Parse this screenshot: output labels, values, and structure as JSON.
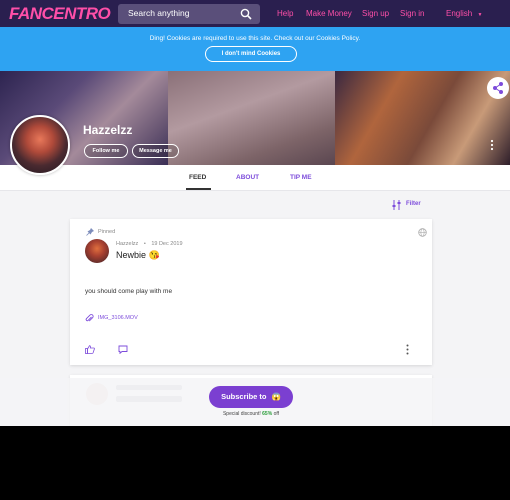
{
  "header": {
    "logo": "FANCENTRO",
    "search_placeholder": "Search anything",
    "links": [
      "Help",
      "Make Money",
      "Sign up",
      "Sign in"
    ],
    "language": "English"
  },
  "cookie_banner": {
    "text": "Ding! Cookies are required to use this site. Check out our Cookies Policy.",
    "button": "I don't mind Cookies"
  },
  "profile": {
    "name": "Hazzelzz",
    "follow_label": "Follow me",
    "message_label": "Message me"
  },
  "tabs": [
    {
      "label": "FEED",
      "active": true
    },
    {
      "label": "ABOUT",
      "active": false
    },
    {
      "label": "TIP ME",
      "active": false
    }
  ],
  "filter_label": "Filter",
  "post": {
    "pinned_label": "Pinned",
    "author": "Hazzelzz",
    "separator": "•",
    "date": "19 Dec 2019",
    "title": "Newbie 😘",
    "body": "you should come play with me",
    "attachment": "IMG_3106.MOV"
  },
  "subscribe": {
    "label": "Subscribe to",
    "emoji": "😱",
    "discount_prefix": "Special discount!",
    "discount_value": "65%",
    "discount_suffix": "off"
  },
  "colors": {
    "nav_bg": "#2a1f4f",
    "accent_pink": "#ff4fa8",
    "cookie_blue": "#2ea3f2",
    "purple": "#7d4cdb",
    "subscribe_purple": "#7b3fd1",
    "discount_green": "#2a9d3a"
  },
  "icons": [
    "search-icon",
    "share-icon",
    "more-vert-icon",
    "pin-icon",
    "globe-icon",
    "paperclip-icon",
    "thumbs-up-icon",
    "comment-icon",
    "filter-sliders-icon",
    "chevron-down-icon"
  ]
}
